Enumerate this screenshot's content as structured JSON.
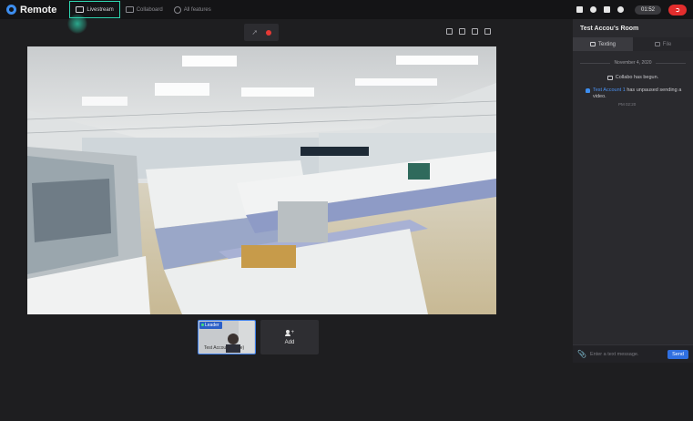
{
  "app": {
    "name": "Remote"
  },
  "nav": [
    {
      "label": "Livestream",
      "icon": "monitor-icon",
      "active": true
    },
    {
      "label": "Collaboard",
      "icon": "edit-board-icon",
      "active": false
    },
    {
      "label": "All features",
      "icon": "gear-icon",
      "active": false
    }
  ],
  "header": {
    "timer": "01:52",
    "accent": "#2fd6b1",
    "leave_color": "#e22d2d"
  },
  "thumbs": {
    "leader_badge": "Leader",
    "leader_name": "Test Account 1 (Me)",
    "add_label": "Add"
  },
  "room": {
    "title": "Test Accou's Room",
    "tabs": [
      {
        "label": "Texting",
        "icon": "chat-icon"
      },
      {
        "label": "File",
        "icon": "folder-icon"
      }
    ],
    "date": "November 4, 2020",
    "system_message": "Collabo has begun.",
    "notice": {
      "user": "Test Account 1",
      "text": "has unpaused sending a video.",
      "time": "PM 02:20"
    },
    "input_placeholder": "Enter a text message.",
    "send_label": "Send"
  }
}
